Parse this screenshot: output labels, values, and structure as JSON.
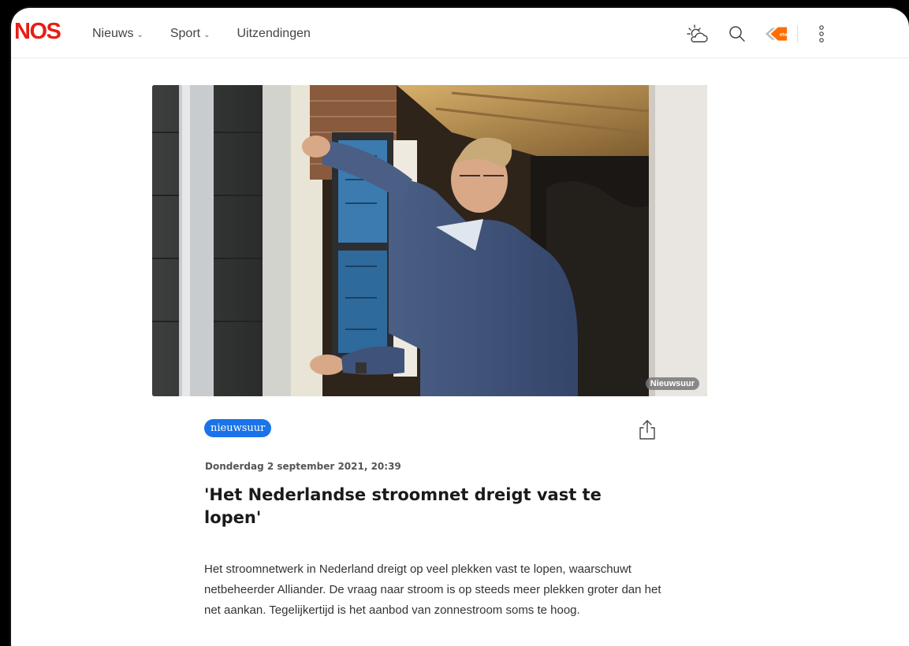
{
  "header": {
    "logo": "NOS",
    "nav": [
      {
        "label": "Nieuws",
        "has_dropdown": true
      },
      {
        "label": "Sport",
        "has_dropdown": true
      },
      {
        "label": "Uitzendingen",
        "has_dropdown": false
      }
    ],
    "tool_icons": [
      "weather-icon",
      "search-icon",
      "npo-start-icon",
      "more-menu-icon"
    ],
    "npo_badge": "start"
  },
  "hero": {
    "badge": "Nieuwsuur"
  },
  "article": {
    "tag": "nieuwsuur",
    "date": "Donderdag 2 september 2021, 20:39",
    "title": "'Het Nederlandse stroomnet dreigt vast te lopen'",
    "lead": "Het stroomnetwerk in Nederland dreigt op veel plekken vast te lopen, waarschuwt netbeheerder Alliander. De vraag naar stroom is op steeds meer plekken groter dan het net aankan. Tegelijkertijd is het aanbod van zonnestroom soms te hoog."
  },
  "colors": {
    "brand_red": "#e61e14",
    "tag_blue": "#1a73e8",
    "npo_orange": "#ff6d00"
  }
}
